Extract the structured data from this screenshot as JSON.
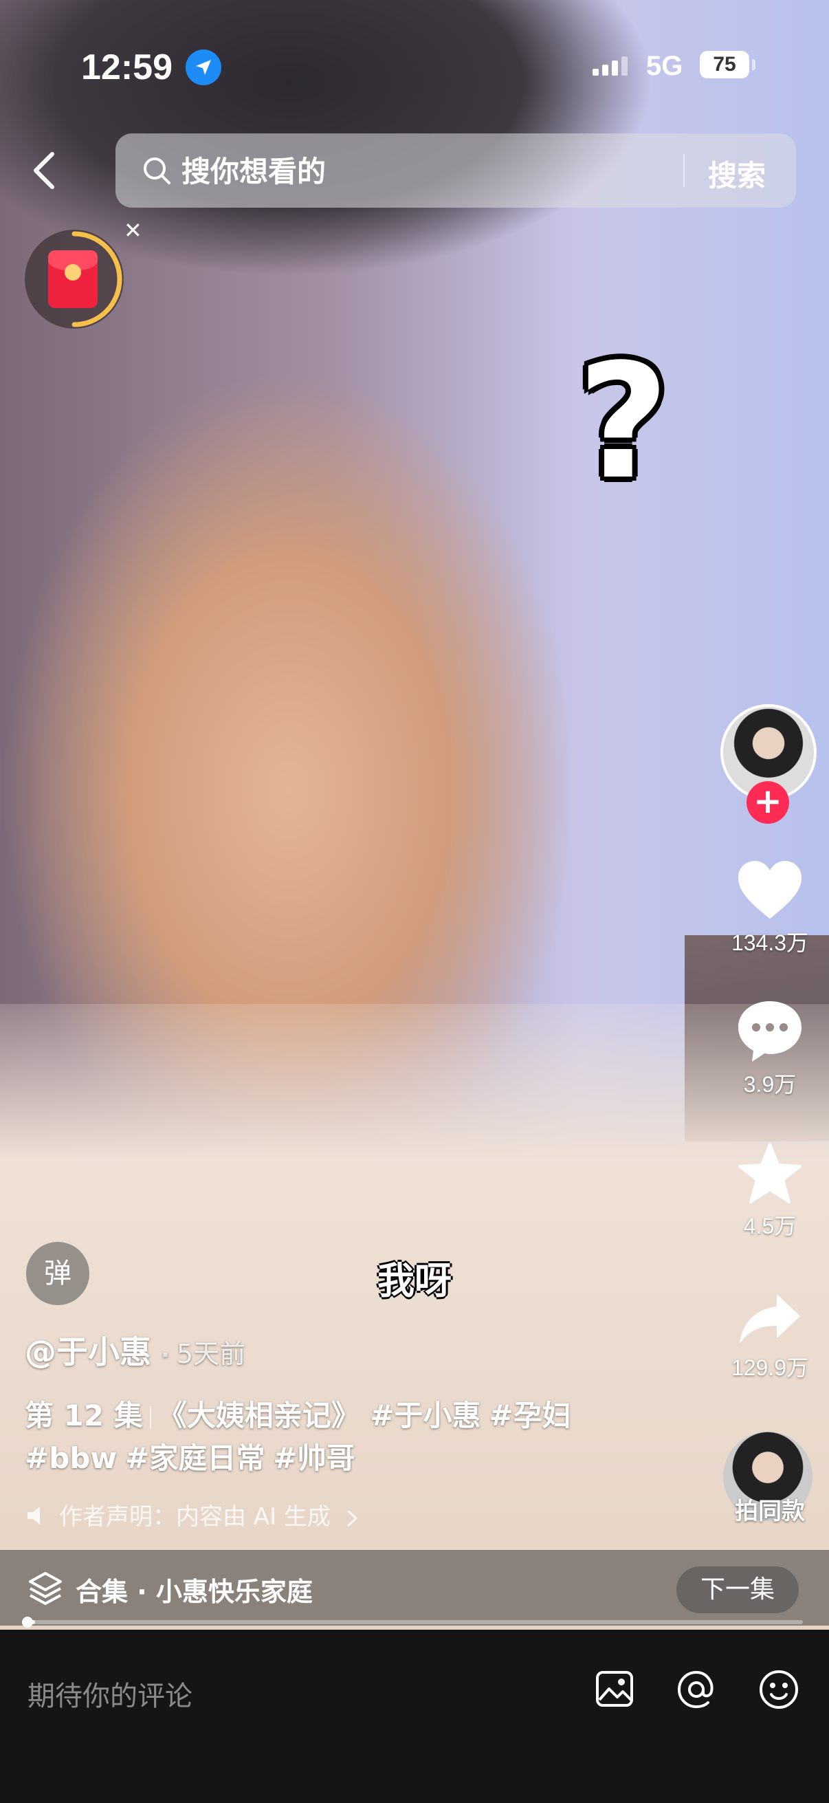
{
  "status_bar": {
    "time": "12:59",
    "network": "5G",
    "battery": "75"
  },
  "search": {
    "placeholder": "搜你想看的",
    "button": "搜索"
  },
  "overlay": {
    "sticker": "?",
    "subtitle": "我呀",
    "danmaku_label": "弹"
  },
  "actions": {
    "likes": "134.3万",
    "comments": "3.9万",
    "favorites": "4.5万",
    "shares": "129.9万",
    "same_style": "拍同款",
    "follow": "+"
  },
  "post": {
    "author": "@于小惠",
    "time_ago": "5天前",
    "episode": "第 12 集",
    "title": "《大姨相亲记》",
    "tags": [
      "#于小惠",
      "#孕妇",
      "#bbw",
      "#家庭日常",
      "#帅哥"
    ],
    "ai_notice": "作者声明：内容由 AI 生成"
  },
  "collection": {
    "label": "合集 · 小惠快乐家庭",
    "next": "下一集",
    "progress": 0.01
  },
  "comment_bar": {
    "placeholder": "期待你的评论"
  },
  "colors": {
    "accent": "#fe2c55",
    "location": "#1e8cf7",
    "bottom_bar": "#151515"
  },
  "icons": [
    "back-icon",
    "search-icon",
    "red-packet-icon",
    "close-icon",
    "heart-icon",
    "comment-icon",
    "star-icon",
    "share-icon",
    "speaker-icon",
    "layers-icon",
    "image-icon",
    "at-icon",
    "emoji-icon",
    "location-icon"
  ]
}
